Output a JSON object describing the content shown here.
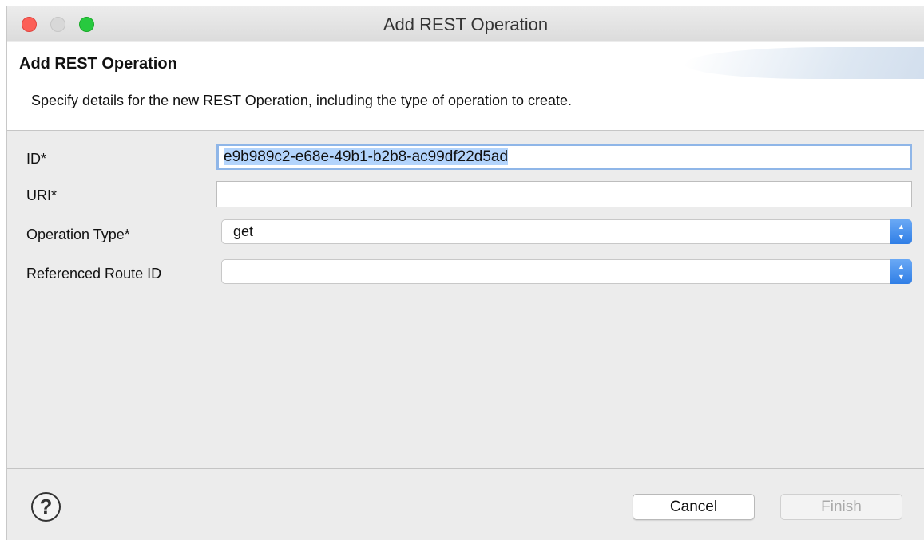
{
  "window": {
    "title": "Add REST Operation"
  },
  "banner": {
    "title": "Add REST Operation",
    "description": "Specify details for the new REST Operation, including the type of operation to create."
  },
  "form": {
    "id_label": "ID*",
    "id_value": "e9b989c2-e68e-49b1-b2b8-ac99df22d5ad",
    "uri_label": "URI*",
    "uri_value": "",
    "operation_type_label": "Operation Type*",
    "operation_type_value": "get",
    "referenced_route_label": "Referenced Route ID",
    "referenced_route_value": ""
  },
  "footer": {
    "help_icon": "?",
    "cancel_label": "Cancel",
    "finish_label": "Finish"
  },
  "icons": {
    "select_up": "▲",
    "select_down": "▼"
  },
  "colors": {
    "close": "#fc5f57",
    "maximize": "#27c93f",
    "accent": "#2f7ee6",
    "focus_ring": "#8fb6e8"
  }
}
